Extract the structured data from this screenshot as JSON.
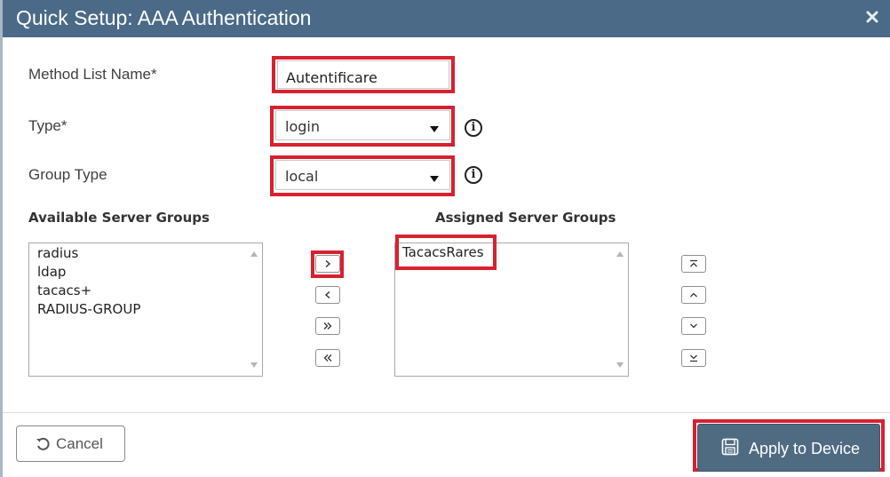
{
  "dialog": {
    "title": "Quick Setup: AAA Authentication",
    "close_icon": "close-icon"
  },
  "form": {
    "method_list_name": {
      "label": "Method List Name*",
      "value": "Autentificare"
    },
    "type": {
      "label": "Type*",
      "value": "login"
    },
    "group_type": {
      "label": "Group Type",
      "value": "local"
    }
  },
  "available_groups": {
    "header": "Available Server Groups",
    "items": [
      "radius",
      "ldap",
      "tacacs+",
      "RADIUS-GROUP"
    ]
  },
  "assigned_groups": {
    "header": "Assigned Server Groups",
    "items": [
      "TacacsRares"
    ]
  },
  "move_buttons": {
    "add": "›",
    "remove": "‹",
    "add_all": "»",
    "remove_all": "«"
  },
  "order_buttons": {
    "to_top": "move-top-icon",
    "up": "chevron-up-icon",
    "down": "chevron-down-icon",
    "to_bottom": "move-bottom-icon"
  },
  "footer": {
    "cancel_label": "Cancel",
    "apply_label": "Apply to Device"
  },
  "colors": {
    "titlebar": "#4a6a87",
    "highlight": "#d8212f",
    "apply_button": "#4f6b82"
  }
}
